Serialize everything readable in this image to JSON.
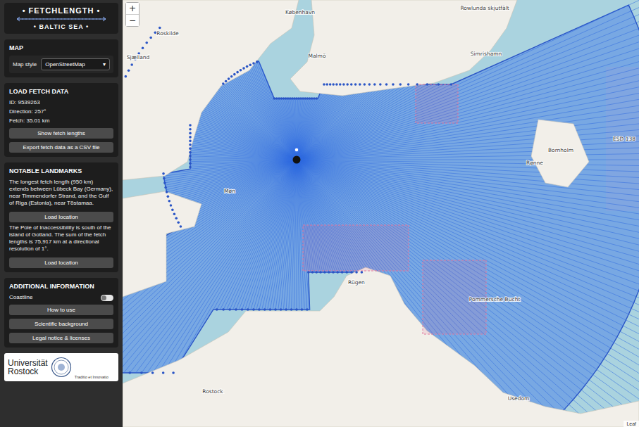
{
  "header": {
    "title": "• FETCHLENGTH •",
    "subtitle": "• BALTIC SEA •"
  },
  "map_panel": {
    "heading": "MAP",
    "label": "Map style",
    "select": {
      "value": "OpenStreetMap",
      "arrow": "▾"
    }
  },
  "fetch_panel": {
    "heading": "LOAD FETCH DATA",
    "lines": [
      "ID: 9539263",
      "Direction: 257°",
      "Fetch: 35.01 km"
    ],
    "buttons": [
      "Show fetch lengths",
      "Export fetch data as a CSV file"
    ]
  },
  "landmarks_panel": {
    "heading": "NOTABLE LANDMARKS",
    "items": [
      {
        "text": "The longest fetch length (950 km) extends between Lübeck Bay (Germany), near Timmendorfer Strand, and the Gulf of Riga (Estonia), near Tõstamaa.",
        "button": "Load location"
      },
      {
        "text": "The Pole of Inaccessibility is south of the island of Gotland. The sum of the fetch lengths is 75,917 km at a directional resolution of 1°.",
        "button": "Load location"
      }
    ]
  },
  "info_panel": {
    "heading": "ADDITIONAL INFORMATION",
    "toggle": {
      "label": "Coastline",
      "on": false
    },
    "buttons": [
      "How to use",
      "Scientific background",
      "Legal notice & licenses"
    ]
  },
  "logo": {
    "name_line1": "Universität",
    "name_line2": "Rostock",
    "motto": "Traditio et Innovatio"
  },
  "map": {
    "zoom_in": "+",
    "zoom_out": "−",
    "attribution": "Leaf",
    "labels": [
      "København",
      "Malmö",
      "Roskilde",
      "Sjælland",
      "Simrishamn",
      "Rowlunda skjutfält",
      "Bornholm",
      "Rønne",
      "ESD 138",
      "Møn",
      "Rügen",
      "Pommersche Bucht",
      "Rostock",
      "Usedom"
    ]
  }
}
